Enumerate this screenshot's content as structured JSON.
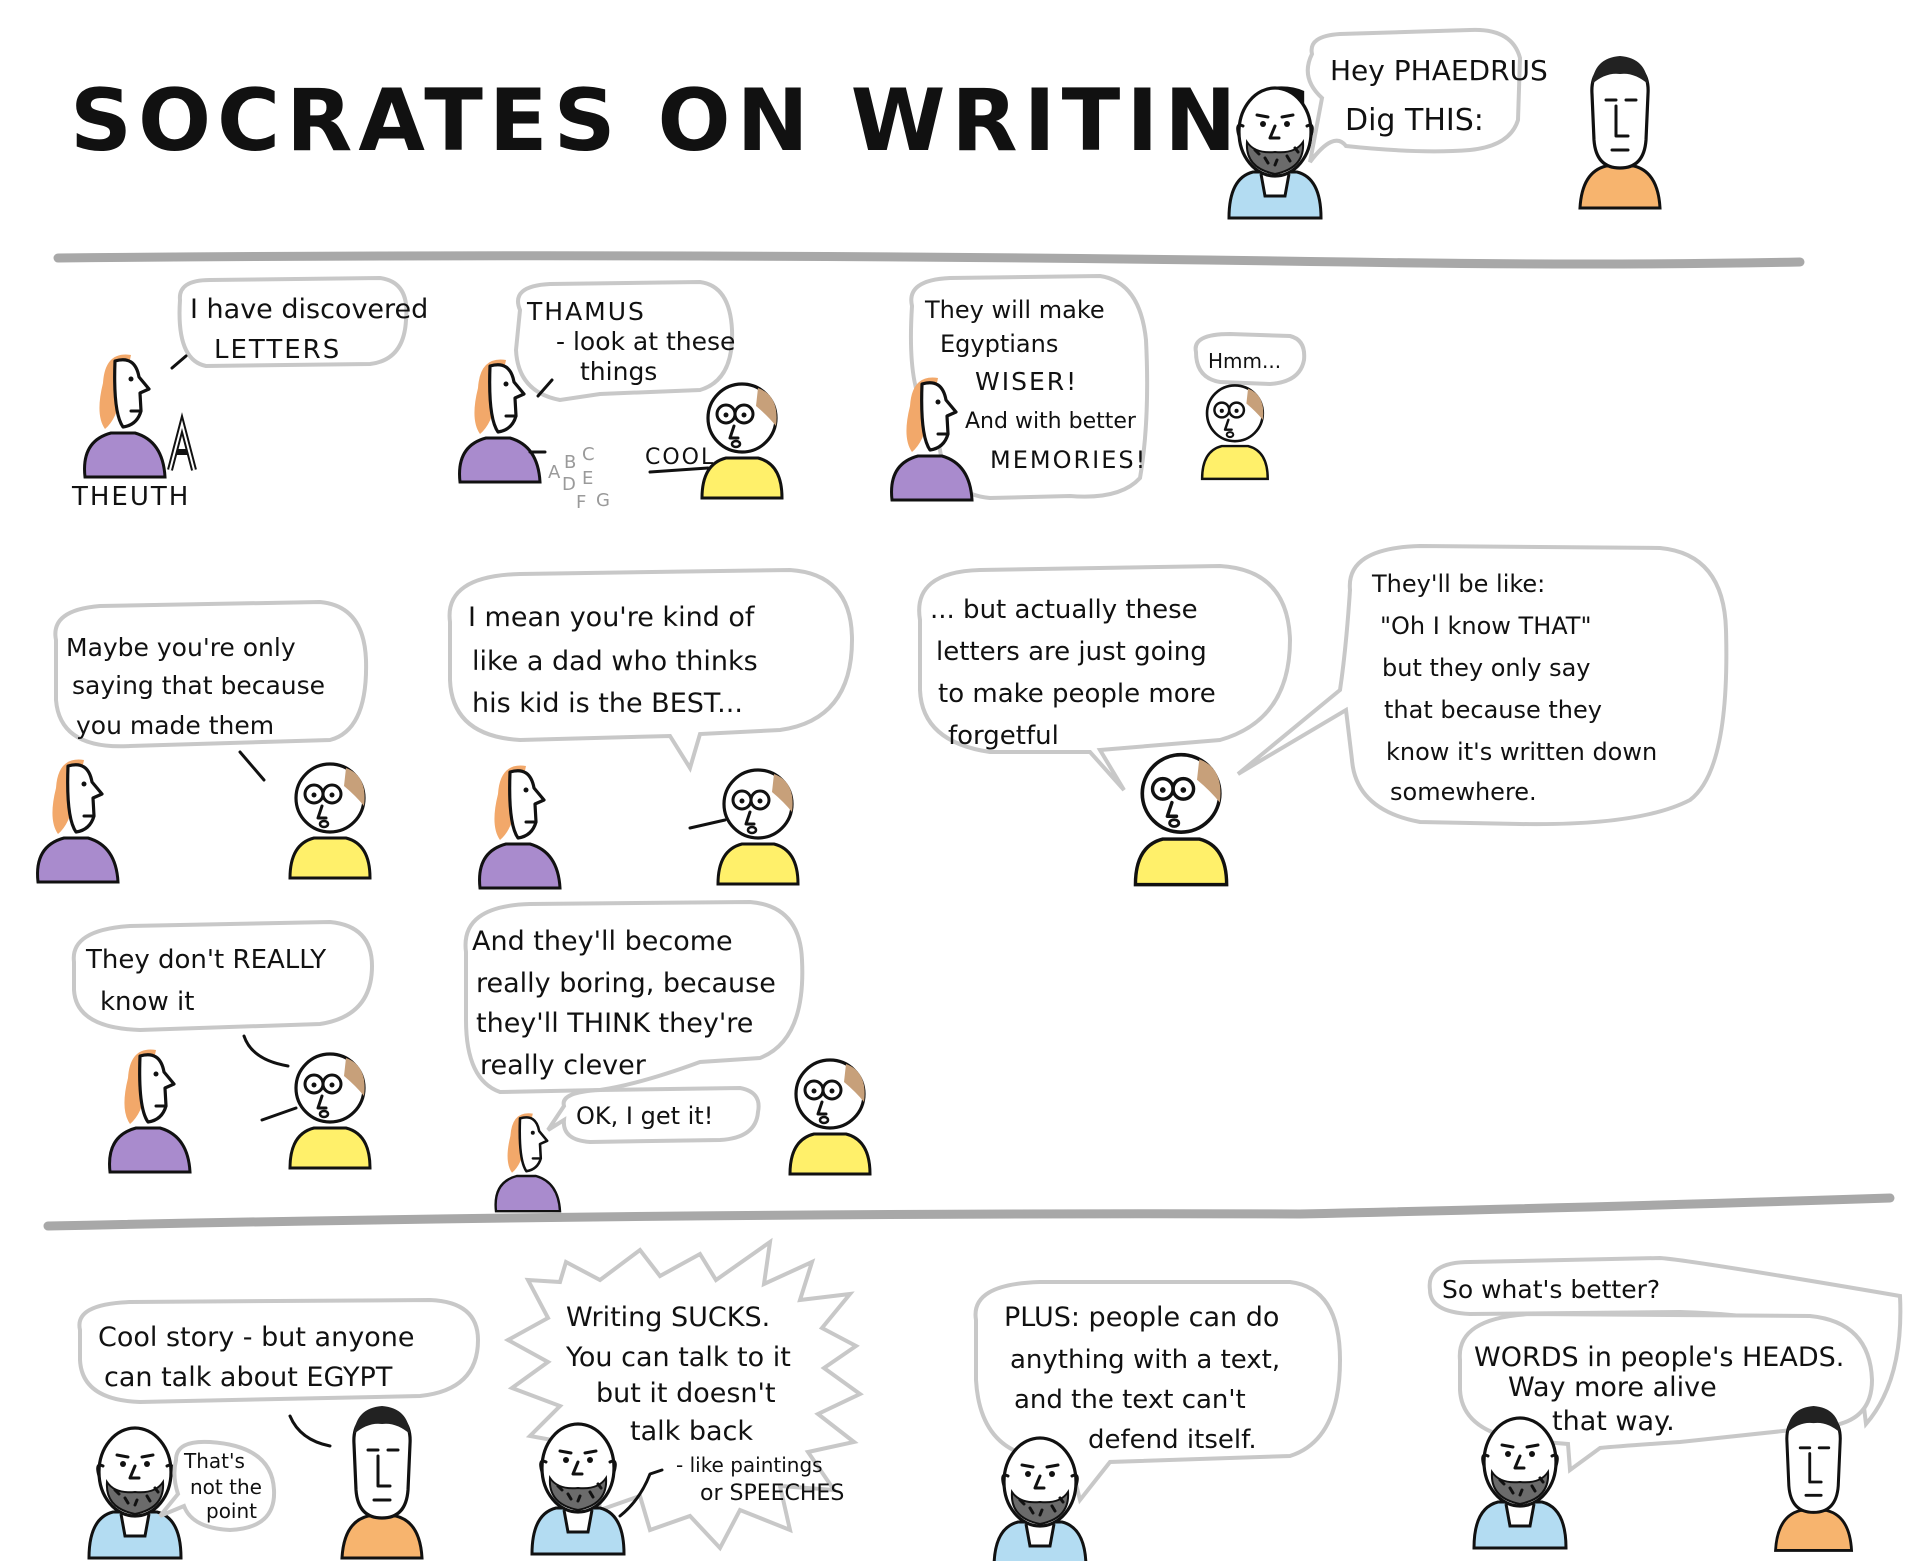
{
  "title": "SOCRATES ON WRITING",
  "colors": {
    "rule": "#a8a8a8",
    "bubble_stroke": "#c8c8c8",
    "socrates_shirt": "#b3dcf2",
    "phaedrus_shirt": "#f7b46e",
    "theuth_robe": "#a98bcd",
    "theuth_hair": "#f2a86a",
    "thamus_shirt": "#fff06a",
    "thamus_hair": "#c7a07a"
  },
  "intro": {
    "line1": "Hey PHAEDRUS",
    "line2": "Dig THIS:"
  },
  "panel1": {
    "bubble": [
      "I have discovered",
      "LETTERS"
    ],
    "caption": "THEUTH"
  },
  "panel2": {
    "bubble": [
      "THAMUS",
      "- look at these",
      "things"
    ],
    "letters": [
      "A",
      "B",
      "C",
      "D",
      "E",
      "F",
      "G"
    ],
    "reply": "COOL"
  },
  "panel3": {
    "bubble": [
      "They will make",
      "Egyptians",
      "WISER!",
      "And with better",
      "MEMORIES!"
    ],
    "reply": "Hmm..."
  },
  "panel4": {
    "bubble": [
      "Maybe you're only",
      "saying that because",
      "you made them"
    ]
  },
  "panel5": {
    "bubble": [
      "I mean you're kind of",
      "like a dad who thinks",
      "his kid is the BEST..."
    ]
  },
  "panel6": {
    "bubble_a": [
      "... but actually these",
      "letters are just going",
      "to make people more",
      "forgetful"
    ],
    "bubble_b": [
      "They'll be like:",
      "\"Oh I know THAT\"",
      "but they only say",
      "that because they",
      "know it's written down",
      "somewhere."
    ]
  },
  "panel7": {
    "bubble": [
      "They don't REALLY",
      "know it"
    ]
  },
  "panel8": {
    "bubble": [
      "And they'll become",
      "really boring, because",
      "they'll THINK they're",
      "really clever"
    ],
    "reply": "OK, I get it!"
  },
  "panel9": {
    "bubble": [
      "Cool story - but anyone",
      "can talk about EGYPT"
    ],
    "aside": [
      "That's",
      "not the",
      "point"
    ]
  },
  "panel10": {
    "bubble": [
      "Writing SUCKS.",
      "You can talk to it",
      "but it doesn't",
      "talk back"
    ],
    "note": [
      "- like paintings",
      "or SPEECHES"
    ]
  },
  "panel11": {
    "bubble": [
      "PLUS: people can do",
      "anything with a text,",
      "and the text can't",
      "defend itself."
    ]
  },
  "panel12": {
    "question": "So what's better?",
    "bubble": [
      "WORDS in people's HEADS.",
      "Way more alive",
      "that way."
    ]
  }
}
